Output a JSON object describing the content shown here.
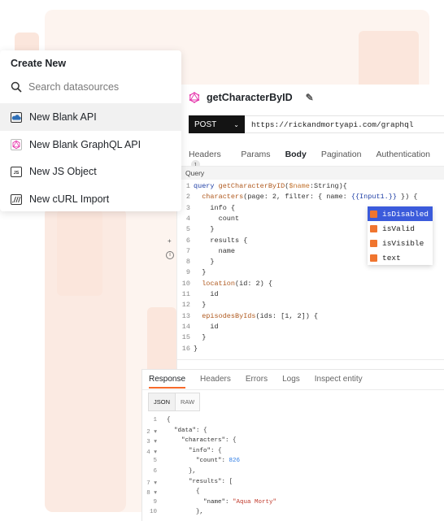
{
  "editor": {
    "title": "getCharacterByID",
    "method": "POST",
    "url": "https://rickandmortyapi.com/graphql",
    "tabs": [
      {
        "label": "Headers",
        "badge": "1"
      },
      {
        "label": "Params"
      },
      {
        "label": "Body"
      },
      {
        "label": "Pagination"
      },
      {
        "label": "Authentication"
      }
    ],
    "active_tab": "Body",
    "query_label": "Query",
    "code_lines": [
      {
        "n": "1",
        "text": "query getCharacterByID($name:String){"
      },
      {
        "n": "2",
        "text": "  characters(page: 2, filter: { name: {{Input1.}} }) {"
      },
      {
        "n": "3",
        "text": "    info {"
      },
      {
        "n": "4",
        "text": "      count"
      },
      {
        "n": "5",
        "text": "    }"
      },
      {
        "n": "6",
        "text": "    results {"
      },
      {
        "n": "7",
        "text": "      name"
      },
      {
        "n": "8",
        "text": "    }"
      },
      {
        "n": "9",
        "text": "  }"
      },
      {
        "n": "10",
        "text": "  location(id: 2) {"
      },
      {
        "n": "11",
        "text": "    id"
      },
      {
        "n": "12",
        "text": "  }"
      },
      {
        "n": "13",
        "text": "  episodesByIds(ids: [1, 2]) {"
      },
      {
        "n": "14",
        "text": "    id"
      },
      {
        "n": "15",
        "text": "  }"
      },
      {
        "n": "16",
        "text": "}"
      }
    ]
  },
  "autocomplete": {
    "items": [
      "isDisabled",
      "isValid",
      "isVisible",
      "text"
    ],
    "selected": "isDisabled"
  },
  "menu": {
    "title": "Create New",
    "search_placeholder": "Search datasources",
    "items": [
      {
        "label": "New Blank API",
        "icon": "cloud-api-icon"
      },
      {
        "label": "New Blank GraphQL API",
        "icon": "graphql-icon"
      },
      {
        "label": "New JS Object",
        "icon": "js-icon"
      },
      {
        "label": "New cURL Import",
        "icon": "curl-icon"
      }
    ]
  },
  "response": {
    "tabs": [
      "Response",
      "Headers",
      "Errors",
      "Logs",
      "Inspect entity"
    ],
    "active_tab": "Response",
    "formats": [
      "JSON",
      "RAW"
    ],
    "lines": [
      {
        "n": "1",
        "text": "{"
      },
      {
        "n": "2",
        "text": "  \"data\": {"
      },
      {
        "n": "3",
        "text": "    \"characters\": {"
      },
      {
        "n": "4",
        "text": "      \"info\": {"
      },
      {
        "n": "5",
        "text": "        \"count\": 826"
      },
      {
        "n": "6",
        "text": "      },"
      },
      {
        "n": "7",
        "text": "      \"results\": ["
      },
      {
        "n": "8",
        "text": "        {"
      },
      {
        "n": "9",
        "text": "          \"name\": \"Aqua Morty\""
      },
      {
        "n": "10",
        "text": "        },"
      }
    ]
  },
  "colors": {
    "accent": "#f86a2b",
    "autocomplete_selected": "#3b5bdb",
    "background_tint": "#fdf4ef"
  }
}
